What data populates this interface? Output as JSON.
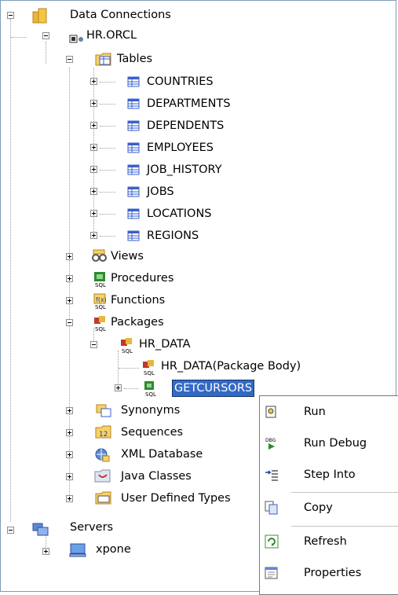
{
  "tree": {
    "data_connections": "Data Connections",
    "connection": "HR.ORCL",
    "tables": {
      "label": "Tables",
      "items": [
        "COUNTRIES",
        "DEPARTMENTS",
        "DEPENDENTS",
        "EMPLOYEES",
        "JOB_HISTORY",
        "JOBS",
        "LOCATIONS",
        "REGIONS"
      ]
    },
    "views": "Views",
    "procedures": "Procedures",
    "functions": "Functions",
    "packages": {
      "label": "Packages",
      "package": "HR_DATA",
      "package_body": "HR_DATA(Package Body)",
      "selected_item": "GETCURSORS"
    },
    "synonyms": "Synonyms",
    "sequences": "Sequences",
    "xml_database": "XML Database",
    "java_classes": "Java Classes",
    "user_defined_types": "User Defined Types",
    "servers": "Servers",
    "server": "xpone"
  },
  "context_menu": {
    "items": [
      {
        "label": "Run",
        "icon": "run-icon"
      },
      {
        "label": "Run Debug",
        "icon": "run-debug-icon"
      },
      {
        "label": "Step Into",
        "icon": "step-into-icon"
      },
      {
        "label": "Copy",
        "icon": "copy-icon"
      },
      {
        "label": "Refresh",
        "icon": "refresh-icon"
      },
      {
        "label": "Properties",
        "icon": "properties-icon"
      }
    ]
  },
  "colors": {
    "selection": "#316ac5",
    "folder": "#f5c542",
    "table_icon": "#3a5fcd",
    "frame": "#7f9db9"
  }
}
